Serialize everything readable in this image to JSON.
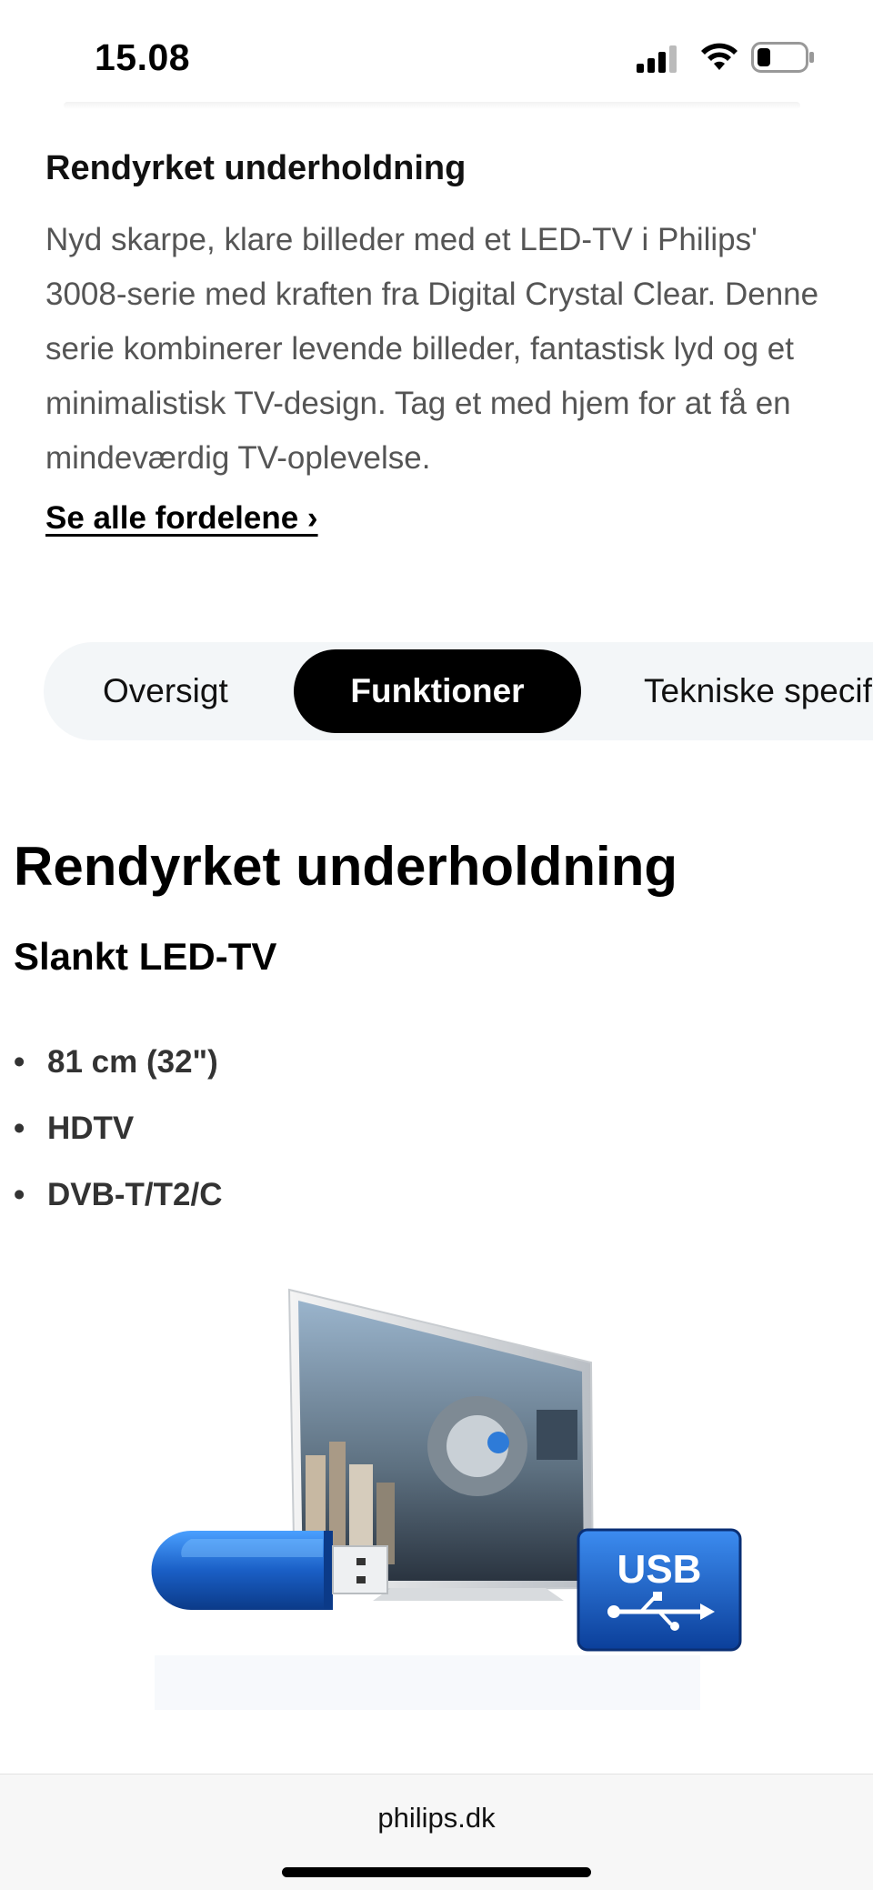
{
  "status_bar": {
    "time": "15.08",
    "icons": [
      "signal-icon",
      "wifi-icon",
      "battery-icon"
    ]
  },
  "intro": {
    "title": "Rendyrket underholdning",
    "body": "Nyd skarpe, klare billeder med et LED-TV i Philips' 3008-serie med kraften fra Digital Crystal Clear. Denne serie kombinerer levende billeder, fantastisk lyd og et minimalistisk TV-design. Tag et med hjem for at få en mindeværdig TV-oplevelse.",
    "link_label": "Se alle fordelene ›"
  },
  "tabs": [
    {
      "label": "Oversigt",
      "active": false
    },
    {
      "label": "Funktioner",
      "active": true
    },
    {
      "label": "Tekniske specifikationer",
      "active": false
    }
  ],
  "features": {
    "heading": "Rendyrket underholdning",
    "subheading": "Slankt LED-TV",
    "bullet_glyph": "•",
    "items": [
      "81 cm (32\")",
      "HDTV",
      "DVB-T/T2/C"
    ]
  },
  "product_image": {
    "usb_badge_text": "USB",
    "accent_color": "#1a5fc6"
  },
  "browser": {
    "url": "philips.dk"
  }
}
